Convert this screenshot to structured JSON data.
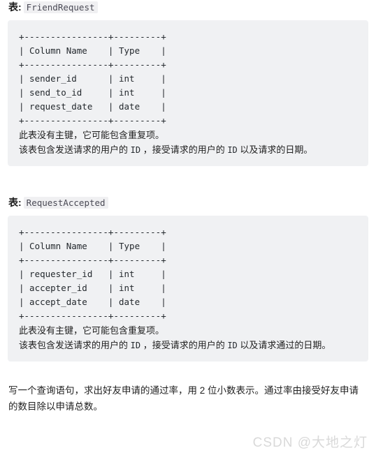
{
  "sections": [
    {
      "label": "表:",
      "table_name": "FriendRequest",
      "ascii_table": "+----------------+---------+\n| Column Name    | Type    |\n+----------------+---------+\n| sender_id      | int     |\n| send_to_id     | int     |\n| request_date   | date    |\n+----------------+---------+",
      "note_line1": "此表没有主键，它可能包含重复项。",
      "note_line2_a": "该表包含发送请求的用户的 ",
      "note_line2_code1": "ID",
      "note_line2_b": " ，接受请求的用户的 ",
      "note_line2_code2": "ID",
      "note_line2_c": " 以及请求的日期。"
    },
    {
      "label": "表:",
      "table_name": "RequestAccepted",
      "ascii_table": "+----------------+---------+\n| Column Name    | Type    |\n+----------------+---------+\n| requester_id   | int     |\n| accepter_id    | int     |\n| accept_date    | date    |\n+----------------+---------+",
      "note_line1": "此表没有主键，它可能包含重复项。",
      "note_line2_a": "该表包含发送请求的用户的 ",
      "note_line2_code1": "ID",
      "note_line2_b": " ，接受请求的用户的 ",
      "note_line2_code2": "ID",
      "note_line2_c": " 以及请求通过的日期。"
    }
  ],
  "prompt": "写一个查询语句，求出好友申请的通过率，用 2 位小数表示。通过率由接受好友申请的数目除以申请总数。",
  "watermark": "CSDN @大地之灯",
  "colors": {
    "code_block_bg": "#f0f1f3",
    "inline_code_bg": "#f0f0f2",
    "text": "#1f1f1f",
    "watermark": "#d9d9d9"
  }
}
